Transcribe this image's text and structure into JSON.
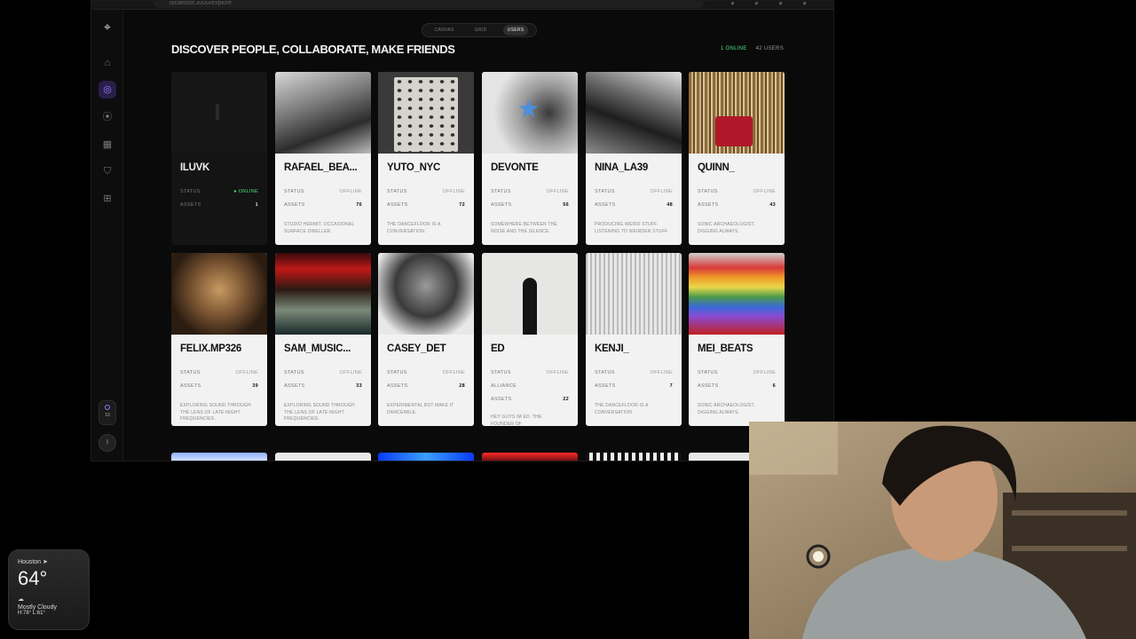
{
  "browser": {
    "url": "localhost:3000/explore"
  },
  "tabs": [
    "CANVAS",
    "GRID",
    "USERS"
  ],
  "active_tab": "USERS",
  "title": "DISCOVER PEOPLE, COLLABORATE, MAKE FRIENDS",
  "stats": {
    "online": "1 ONLINE",
    "users": "42 USERS"
  },
  "labels": {
    "status": "STATUS",
    "assets": "ASSETS",
    "alliance": "ALLIANCE"
  },
  "rail": {
    "badge_count": "10",
    "avatar": "I"
  },
  "users": [
    {
      "name": "ILUVK",
      "status": "ONLINE",
      "assets": "1",
      "bio": ""
    },
    {
      "name": "RAFAEL_BEA...",
      "status": "OFFLINE",
      "assets": "76",
      "bio": "STUDIO HERMIT. OCCASIONAL SURFACE DWELLER."
    },
    {
      "name": "YUTO_NYC",
      "status": "OFFLINE",
      "assets": "72",
      "bio": "THE DANCEFLOOR IS A CONVERSATION."
    },
    {
      "name": "DEVONTE",
      "status": "OFFLINE",
      "assets": "56",
      "bio": "SOMEWHERE BETWEEN THE NOISE AND THE SILENCE."
    },
    {
      "name": "NINA_LA39",
      "status": "OFFLINE",
      "assets": "48",
      "bio": "PRODUCING WEIRD STUFF. LISTENING TO WEIRDER STUFF."
    },
    {
      "name": "QUINN_",
      "status": "OFFLINE",
      "assets": "43",
      "bio": "SONIC ARCHAEOLOGIST. DIGGING ALWAYS."
    },
    {
      "name": "FELIX.MP326",
      "status": "OFFLINE",
      "assets": "39",
      "bio": "EXPLORING SOUND THROUGH THE LENS OF LATE-NIGHT FREQUENCIES."
    },
    {
      "name": "SAM_MUSIC...",
      "status": "OFFLINE",
      "assets": "33",
      "bio": "EXPLORING SOUND THROUGH THE LENS OF LATE-NIGHT FREQUENCIES."
    },
    {
      "name": "CASEY_DET",
      "status": "OFFLINE",
      "assets": "28",
      "bio": "EXPERIMENTAL BUT MAKE IT DANCEABLE."
    },
    {
      "name": "ED",
      "status": "OFFLINE",
      "assets": "22",
      "bio": "HEY GUYS IM ED. THE FOUNDER OF BOREDMOODSTUDIOS, GO..."
    },
    {
      "name": "KENJI_",
      "status": "OFFLINE",
      "assets": "7",
      "bio": "THE DANCEFLOOR IS A CONVERSATION."
    },
    {
      "name": "MEI_BEATS",
      "status": "OFFLINE",
      "assets": "6",
      "bio": "SONIC ARCHAEOLOGIST. DIGGING ALWAYS."
    }
  ],
  "weather": {
    "city": "Houston",
    "temp": "64°",
    "condition": "Mostly Cloudy",
    "hilo": "H:78° L:61°"
  },
  "colors": {
    "online": "#4ade80",
    "accent": "#9b7bff"
  }
}
